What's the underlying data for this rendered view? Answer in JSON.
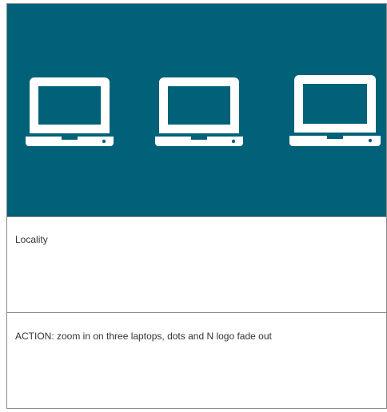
{
  "frame": {
    "background_color": "#006178",
    "icon_color": "#ffffff",
    "icons": [
      "laptop-icon",
      "laptop-icon",
      "laptop-icon"
    ]
  },
  "rows": {
    "scene_label": "Locality",
    "action_note": "ACTION: zoom in on three laptops, dots and N logo fade out"
  }
}
